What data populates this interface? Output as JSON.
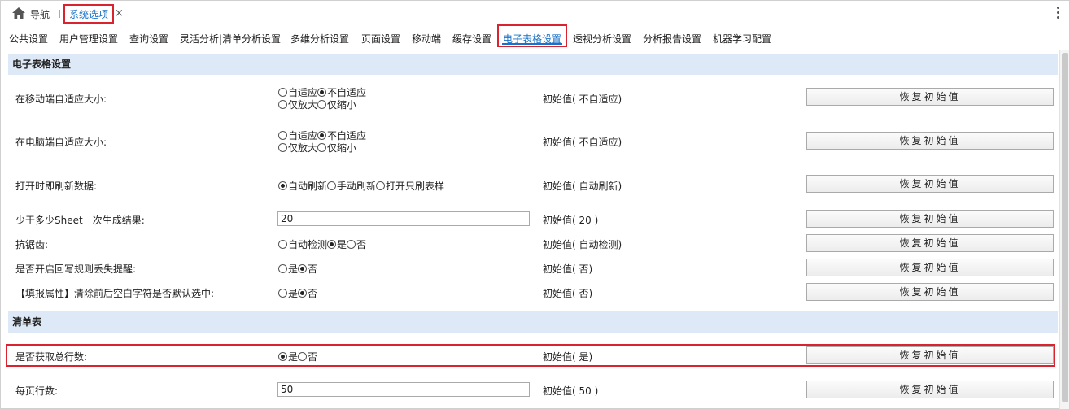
{
  "header": {
    "nav_label": "导航",
    "active_tab": "系统选项",
    "close_glyph": "×"
  },
  "subtabs": [
    {
      "label": "公共设置"
    },
    {
      "label": "用户管理设置"
    },
    {
      "label": "查询设置"
    },
    {
      "label": "灵活分析|清单分析设置"
    },
    {
      "label": "多维分析设置"
    },
    {
      "label": "页面设置"
    },
    {
      "label": "移动端"
    },
    {
      "label": "缓存设置"
    },
    {
      "label": "电子表格设置"
    },
    {
      "label": "透视分析设置"
    },
    {
      "label": "分析报告设置"
    },
    {
      "label": "机器学习配置"
    }
  ],
  "reset_label": "恢复初始值",
  "sections": {
    "spreadsheet": "电子表格设置",
    "list": "清单表"
  },
  "settings": {
    "mobile_adapt": {
      "label": "在移动端自适应大小:",
      "line1": [
        "自适应",
        "不自适应"
      ],
      "line2": [
        "仅放大",
        "仅缩小"
      ],
      "default": "初始值( 不自适应)"
    },
    "pc_adapt": {
      "label": "在电脑端自适应大小:",
      "line1": [
        "自适应",
        "不自适应"
      ],
      "line2": [
        "仅放大",
        "仅缩小"
      ],
      "default": "初始值( 不自适应)"
    },
    "refresh_on_open": {
      "label": "打开时即刷新数据:",
      "options": [
        "自动刷新",
        "手动刷新",
        "打开只刷表样"
      ],
      "default": "初始值( 自动刷新)"
    },
    "sheet_batch": {
      "label": "少于多少Sheet一次生成结果:",
      "value": "20",
      "default": "初始值( 20 )"
    },
    "antialias": {
      "label": "抗锯齿:",
      "options": [
        "自动检测",
        "是",
        "否"
      ],
      "default": "初始值( 自动检测)"
    },
    "writeback_warn": {
      "label": "是否开启回写规则丢失提醒:",
      "options": [
        "是",
        "否"
      ],
      "default": "初始值( 否)"
    },
    "fill_attr_trim": {
      "label": "【填报属性】清除前后空白字符是否默认选中:",
      "options": [
        "是",
        "否"
      ],
      "default": "初始值( 否)"
    },
    "get_total_rows": {
      "label": "是否获取总行数:",
      "options": [
        "是",
        "否"
      ],
      "default": "初始值( 是)"
    },
    "rows_per_page": {
      "label": "每页行数:",
      "value": "50",
      "default": "初始值( 50 )"
    }
  }
}
